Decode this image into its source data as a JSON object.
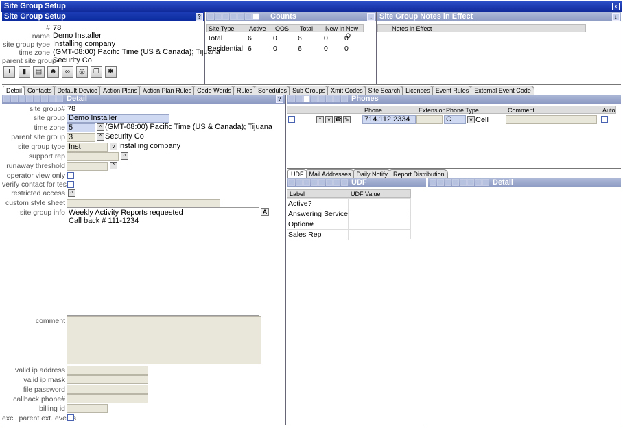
{
  "window": {
    "title": "Site Group Setup",
    "close": "x"
  },
  "header_panel": {
    "title": "Site Group Setup",
    "help": "?",
    "number_label": "#",
    "number": "78",
    "name_label": "name",
    "name": "Demo Installer",
    "type_label": "site group type",
    "type": "Installing company",
    "tz_label": "time zone",
    "tz": "(GMT-08:00) Pacific Time (US & Canada); Tijuana",
    "parent_label": "parent site group",
    "parent": "Security Co",
    "icons": [
      "text-icon",
      "chart-icon",
      "document-icon",
      "person-icon",
      "link-icon",
      "target-icon",
      "copy-icon",
      "sparkle-icon"
    ]
  },
  "counts": {
    "title": "Counts",
    "columns": [
      "Site Type",
      "Active",
      "OOS",
      "Total",
      "New In",
      "New O"
    ],
    "rows": [
      [
        "Total",
        "6",
        "0",
        "6",
        "0",
        "0"
      ],
      [
        "Residential",
        "6",
        "0",
        "6",
        "0",
        "0"
      ]
    ]
  },
  "notes": {
    "title": "Site Group Notes in Effect",
    "column": "Notes in Effect"
  },
  "main_tabs": [
    "Detail",
    "Contacts",
    "Default Device",
    "Action Plans",
    "Action Plan Rules",
    "Code Words",
    "Rules",
    "Schedules",
    "Sub Groups",
    "Xmit Codes",
    "Site Search",
    "Licenses",
    "Event Rules",
    "External Event Code"
  ],
  "detail": {
    "title": "Detail",
    "help": "?",
    "f_num_label": "site group#",
    "f_num": "78",
    "f_sg_label": "site group",
    "f_sg": "Demo Installer",
    "f_tz_label": "time zone",
    "f_tz_code": "5",
    "f_tz": "(GMT-08:00) Pacific Time (US & Canada); Tijuana",
    "f_parent_label": "parent site group",
    "f_parent_code": "3",
    "f_parent": "Security Co",
    "f_type_label": "site group type",
    "f_type_code": "Inst",
    "f_type": "Installing company",
    "f_support_label": "support rep",
    "f_runaway_label": "runaway threshold",
    "f_opview_label": "operator view only",
    "f_verify_label": "verify contact for test",
    "f_restricted_label": "restricted access",
    "f_style_label": "custom style sheet",
    "f_info_label": "site group info",
    "f_info_line1": "Weekly Activity Reports requested",
    "f_info_line2": "Call back # 111-1234",
    "f_info_btn": "A",
    "f_comment_label": "comment",
    "f_ip_label": "valid ip address",
    "f_mask_label": "valid ip mask",
    "f_pw_label": "file password",
    "f_cb_label": "callback phone#",
    "f_bill_label": "billing id",
    "f_excl_label": "excl. parent ext. events"
  },
  "phones": {
    "title": "Phones",
    "columns": [
      "Phone",
      "Extension",
      "Phone Type",
      "Comment",
      "Auto"
    ],
    "row": {
      "phone": "714.112.2334",
      "type_code": "C",
      "type": "Cell"
    }
  },
  "sub_tabs": [
    "UDF",
    "Mail Addresses",
    "Daily Notify",
    "Report Distribution"
  ],
  "udf": {
    "title": "UDF",
    "columns": [
      "Label",
      "UDF Value"
    ],
    "rows": [
      "Active?",
      "Answering Service",
      "Option#",
      "Sales Rep"
    ]
  },
  "udf_detail": {
    "title": "Detail"
  }
}
